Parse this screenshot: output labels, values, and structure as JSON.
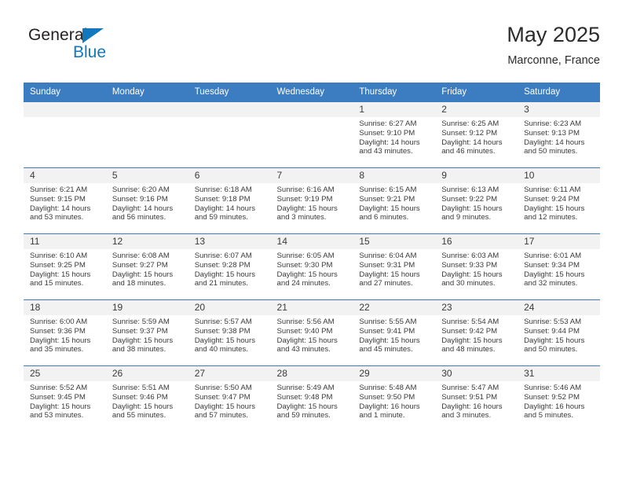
{
  "brand": {
    "name_part1": "General",
    "name_part2": "Blue",
    "accent_color": "#1278be",
    "triangle_icon": "triangle-icon"
  },
  "header": {
    "title": "May 2025",
    "subtitle": "Marconne, France"
  },
  "calendar": {
    "header_color": "#3b7dc0",
    "weekdays": [
      "Sunday",
      "Monday",
      "Tuesday",
      "Wednesday",
      "Thursday",
      "Friday",
      "Saturday"
    ],
    "weeks": [
      [
        {
          "day": "",
          "sunrise": "",
          "sunset": "",
          "daylight1": "",
          "daylight2": ""
        },
        {
          "day": "",
          "sunrise": "",
          "sunset": "",
          "daylight1": "",
          "daylight2": ""
        },
        {
          "day": "",
          "sunrise": "",
          "sunset": "",
          "daylight1": "",
          "daylight2": ""
        },
        {
          "day": "",
          "sunrise": "",
          "sunset": "",
          "daylight1": "",
          "daylight2": ""
        },
        {
          "day": "1",
          "sunrise": "Sunrise: 6:27 AM",
          "sunset": "Sunset: 9:10 PM",
          "daylight1": "Daylight: 14 hours",
          "daylight2": "and 43 minutes."
        },
        {
          "day": "2",
          "sunrise": "Sunrise: 6:25 AM",
          "sunset": "Sunset: 9:12 PM",
          "daylight1": "Daylight: 14 hours",
          "daylight2": "and 46 minutes."
        },
        {
          "day": "3",
          "sunrise": "Sunrise: 6:23 AM",
          "sunset": "Sunset: 9:13 PM",
          "daylight1": "Daylight: 14 hours",
          "daylight2": "and 50 minutes."
        }
      ],
      [
        {
          "day": "4",
          "sunrise": "Sunrise: 6:21 AM",
          "sunset": "Sunset: 9:15 PM",
          "daylight1": "Daylight: 14 hours",
          "daylight2": "and 53 minutes."
        },
        {
          "day": "5",
          "sunrise": "Sunrise: 6:20 AM",
          "sunset": "Sunset: 9:16 PM",
          "daylight1": "Daylight: 14 hours",
          "daylight2": "and 56 minutes."
        },
        {
          "day": "6",
          "sunrise": "Sunrise: 6:18 AM",
          "sunset": "Sunset: 9:18 PM",
          "daylight1": "Daylight: 14 hours",
          "daylight2": "and 59 minutes."
        },
        {
          "day": "7",
          "sunrise": "Sunrise: 6:16 AM",
          "sunset": "Sunset: 9:19 PM",
          "daylight1": "Daylight: 15 hours",
          "daylight2": "and 3 minutes."
        },
        {
          "day": "8",
          "sunrise": "Sunrise: 6:15 AM",
          "sunset": "Sunset: 9:21 PM",
          "daylight1": "Daylight: 15 hours",
          "daylight2": "and 6 minutes."
        },
        {
          "day": "9",
          "sunrise": "Sunrise: 6:13 AM",
          "sunset": "Sunset: 9:22 PM",
          "daylight1": "Daylight: 15 hours",
          "daylight2": "and 9 minutes."
        },
        {
          "day": "10",
          "sunrise": "Sunrise: 6:11 AM",
          "sunset": "Sunset: 9:24 PM",
          "daylight1": "Daylight: 15 hours",
          "daylight2": "and 12 minutes."
        }
      ],
      [
        {
          "day": "11",
          "sunrise": "Sunrise: 6:10 AM",
          "sunset": "Sunset: 9:25 PM",
          "daylight1": "Daylight: 15 hours",
          "daylight2": "and 15 minutes."
        },
        {
          "day": "12",
          "sunrise": "Sunrise: 6:08 AM",
          "sunset": "Sunset: 9:27 PM",
          "daylight1": "Daylight: 15 hours",
          "daylight2": "and 18 minutes."
        },
        {
          "day": "13",
          "sunrise": "Sunrise: 6:07 AM",
          "sunset": "Sunset: 9:28 PM",
          "daylight1": "Daylight: 15 hours",
          "daylight2": "and 21 minutes."
        },
        {
          "day": "14",
          "sunrise": "Sunrise: 6:05 AM",
          "sunset": "Sunset: 9:30 PM",
          "daylight1": "Daylight: 15 hours",
          "daylight2": "and 24 minutes."
        },
        {
          "day": "15",
          "sunrise": "Sunrise: 6:04 AM",
          "sunset": "Sunset: 9:31 PM",
          "daylight1": "Daylight: 15 hours",
          "daylight2": "and 27 minutes."
        },
        {
          "day": "16",
          "sunrise": "Sunrise: 6:03 AM",
          "sunset": "Sunset: 9:33 PM",
          "daylight1": "Daylight: 15 hours",
          "daylight2": "and 30 minutes."
        },
        {
          "day": "17",
          "sunrise": "Sunrise: 6:01 AM",
          "sunset": "Sunset: 9:34 PM",
          "daylight1": "Daylight: 15 hours",
          "daylight2": "and 32 minutes."
        }
      ],
      [
        {
          "day": "18",
          "sunrise": "Sunrise: 6:00 AM",
          "sunset": "Sunset: 9:36 PM",
          "daylight1": "Daylight: 15 hours",
          "daylight2": "and 35 minutes."
        },
        {
          "day": "19",
          "sunrise": "Sunrise: 5:59 AM",
          "sunset": "Sunset: 9:37 PM",
          "daylight1": "Daylight: 15 hours",
          "daylight2": "and 38 minutes."
        },
        {
          "day": "20",
          "sunrise": "Sunrise: 5:57 AM",
          "sunset": "Sunset: 9:38 PM",
          "daylight1": "Daylight: 15 hours",
          "daylight2": "and 40 minutes."
        },
        {
          "day": "21",
          "sunrise": "Sunrise: 5:56 AM",
          "sunset": "Sunset: 9:40 PM",
          "daylight1": "Daylight: 15 hours",
          "daylight2": "and 43 minutes."
        },
        {
          "day": "22",
          "sunrise": "Sunrise: 5:55 AM",
          "sunset": "Sunset: 9:41 PM",
          "daylight1": "Daylight: 15 hours",
          "daylight2": "and 45 minutes."
        },
        {
          "day": "23",
          "sunrise": "Sunrise: 5:54 AM",
          "sunset": "Sunset: 9:42 PM",
          "daylight1": "Daylight: 15 hours",
          "daylight2": "and 48 minutes."
        },
        {
          "day": "24",
          "sunrise": "Sunrise: 5:53 AM",
          "sunset": "Sunset: 9:44 PM",
          "daylight1": "Daylight: 15 hours",
          "daylight2": "and 50 minutes."
        }
      ],
      [
        {
          "day": "25",
          "sunrise": "Sunrise: 5:52 AM",
          "sunset": "Sunset: 9:45 PM",
          "daylight1": "Daylight: 15 hours",
          "daylight2": "and 53 minutes."
        },
        {
          "day": "26",
          "sunrise": "Sunrise: 5:51 AM",
          "sunset": "Sunset: 9:46 PM",
          "daylight1": "Daylight: 15 hours",
          "daylight2": "and 55 minutes."
        },
        {
          "day": "27",
          "sunrise": "Sunrise: 5:50 AM",
          "sunset": "Sunset: 9:47 PM",
          "daylight1": "Daylight: 15 hours",
          "daylight2": "and 57 minutes."
        },
        {
          "day": "28",
          "sunrise": "Sunrise: 5:49 AM",
          "sunset": "Sunset: 9:48 PM",
          "daylight1": "Daylight: 15 hours",
          "daylight2": "and 59 minutes."
        },
        {
          "day": "29",
          "sunrise": "Sunrise: 5:48 AM",
          "sunset": "Sunset: 9:50 PM",
          "daylight1": "Daylight: 16 hours",
          "daylight2": "and 1 minute."
        },
        {
          "day": "30",
          "sunrise": "Sunrise: 5:47 AM",
          "sunset": "Sunset: 9:51 PM",
          "daylight1": "Daylight: 16 hours",
          "daylight2": "and 3 minutes."
        },
        {
          "day": "31",
          "sunrise": "Sunrise: 5:46 AM",
          "sunset": "Sunset: 9:52 PM",
          "daylight1": "Daylight: 16 hours",
          "daylight2": "and 5 minutes."
        }
      ]
    ]
  }
}
